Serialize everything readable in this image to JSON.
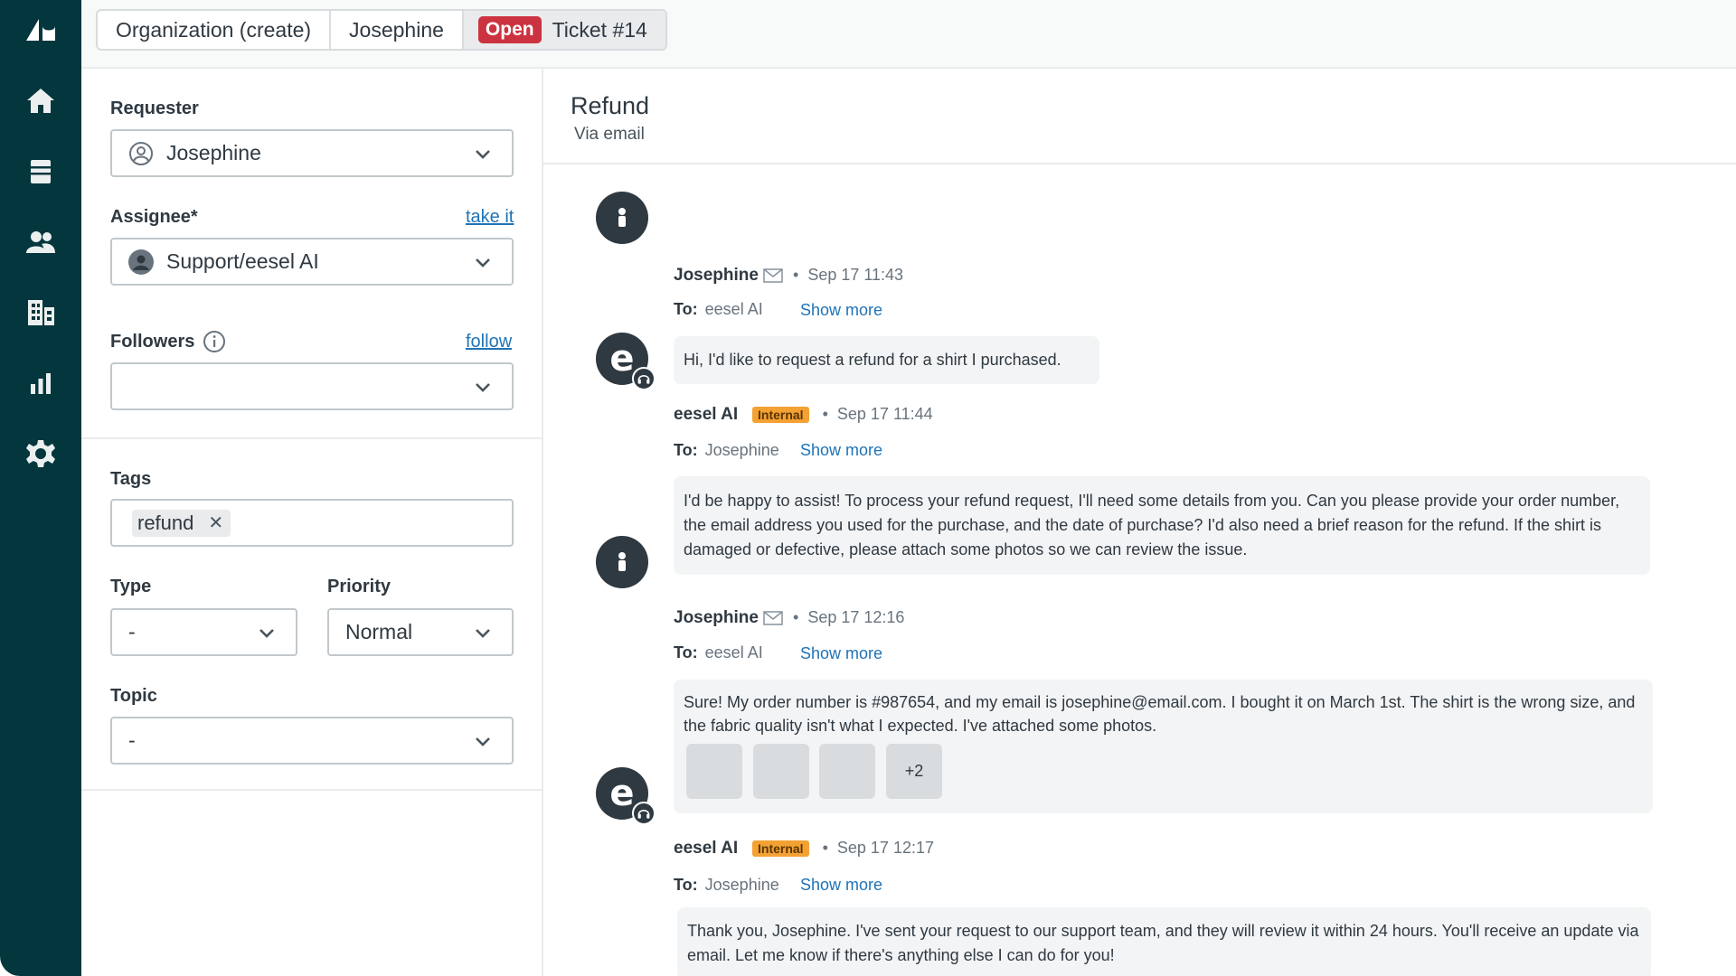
{
  "tabs": [
    {
      "label": "Organization (create)"
    },
    {
      "label": "Josephine"
    },
    {
      "status": "Open",
      "label": "Ticket #14"
    }
  ],
  "nav": {
    "items": [
      "logo-icon",
      "home-icon",
      "views-icon",
      "customers-icon",
      "organizations-icon",
      "reporting-icon",
      "settings-icon"
    ]
  },
  "props": {
    "requester": {
      "label": "Requester",
      "value": "Josephine"
    },
    "assignee": {
      "label": "Assignee*",
      "link": "take it",
      "value": "Support/eesel AI"
    },
    "followers": {
      "label": "Followers",
      "link": "follow",
      "value": ""
    },
    "tags": {
      "label": "Tags",
      "items": [
        "refund"
      ]
    },
    "type": {
      "label": "Type",
      "value": "-"
    },
    "priority": {
      "label": "Priority",
      "value": "Normal"
    },
    "topic": {
      "label": "Topic",
      "value": "-"
    }
  },
  "conversation": {
    "subject": "Refund",
    "via": "Via email",
    "messages": [
      {
        "author": "Josephine",
        "time": "Sep 17 11:43",
        "to_label": "To:",
        "to": "eesel AI",
        "show_more": "Show more",
        "body": "Hi, I'd like to request a refund for a shirt I purchased."
      },
      {
        "author": "eesel AI",
        "badge": "Internal",
        "time": "Sep 17 11:44",
        "to_label": "To:",
        "to": "Josephine",
        "show_more": "Show more",
        "body": "I'd be happy to assist! To process your refund request, I'll need some details from you. Can you please provide your order number, the email address you used for the purchase, and the date of purchase? I'd also need a brief reason for the refund. If the shirt is damaged or defective, please attach some photos so we can review the issue."
      },
      {
        "author": "Josephine",
        "time": "Sep 17 12:16",
        "to_label": "To:",
        "to": "eesel AI",
        "show_more": "Show more",
        "body": "Sure! My order number is #987654, and my email is josephine@email.com. I bought it on March 1st. The shirt is the wrong size, and the fabric quality isn't what I expected. I've attached some photos.",
        "attachments_more": "+2"
      },
      {
        "author": "eesel AI",
        "badge": "Internal",
        "time": "Sep 17 12:17",
        "to_label": "To:",
        "to": "Josephine",
        "show_more": "Show more",
        "body": "Thank you, Josephine. I've sent your request to our support team, and they will review it within 24 hours. You'll receive an update via email. Let me know if there's anything else I can do for you!"
      }
    ]
  },
  "colors": {
    "nav_bg": "#03363d",
    "open_badge": "#cc3340",
    "link": "#1f73b7",
    "internal_badge": "#f4a134",
    "bubble_bg": "#f3f4f5"
  }
}
